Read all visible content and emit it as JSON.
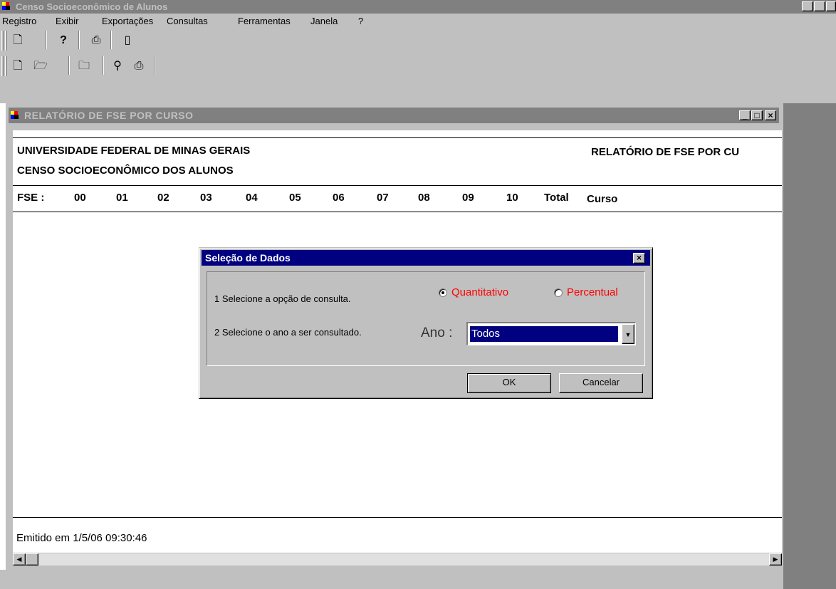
{
  "app": {
    "title": "Censo Socioeconômico de Alunos"
  },
  "menu": [
    "Registro",
    "Exibir",
    "Exportações",
    "Consultas",
    "Ferramentas",
    "Janela",
    "?"
  ],
  "toolbar1": [
    "new-document-icon",
    "help-icon",
    "print-icon",
    "exit-icon"
  ],
  "toolbar2": [
    "new-document-icon",
    "open-folder-icon",
    "folder-icon",
    "find-icon",
    "print-icon"
  ],
  "child_window": {
    "title": "RELATÓRIO DE FSE  POR CURSO"
  },
  "report": {
    "line1": "UNIVERSIDADE FEDERAL DE MINAS GERAIS",
    "line2": "CENSO SOCIOECONÔMICO DOS ALUNOS",
    "right_title": "RELATÓRIO DE FSE  POR CU",
    "fse_label": "FSE :",
    "columns": [
      "00",
      "01",
      "02",
      "03",
      "04",
      "05",
      "06",
      "07",
      "08",
      "09",
      "10",
      "Total"
    ],
    "curso_label": "Curso",
    "footer": "Emitido em 1/5/06 09:30:46"
  },
  "dialog": {
    "title": "Seleção de Dados",
    "step1": "1 Selecione a opção de consulta.",
    "step2": "2 Selecione o ano a ser consultado.",
    "option_quant": "Quantitativo",
    "option_perc": "Percentual",
    "ano_label": "Ano :",
    "ano_value": "Todos",
    "ok": "OK",
    "cancel": "Cancelar"
  },
  "colors": {
    "dialog_title": "#000080",
    "option_text": "#ff0000",
    "inactive_title": "#808080"
  }
}
